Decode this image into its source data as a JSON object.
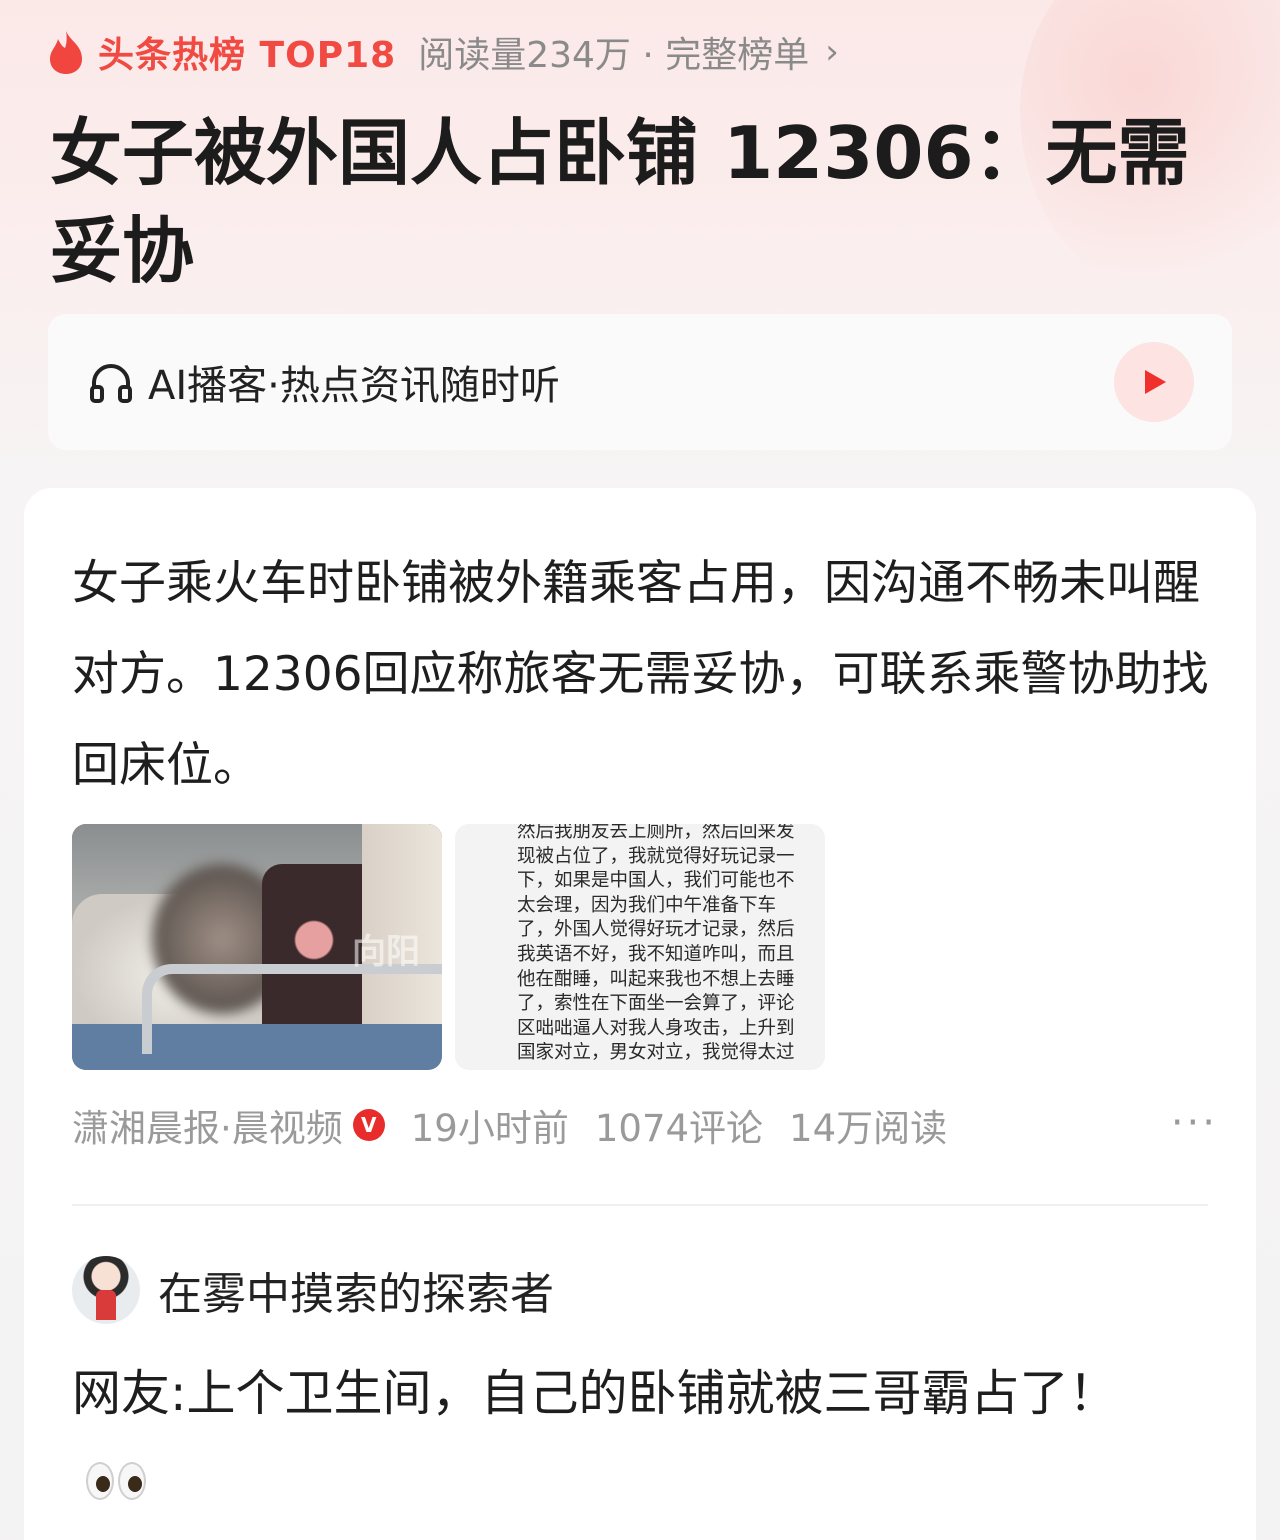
{
  "header": {
    "hot_label": "头条热榜 TOP18",
    "meta": "阅读量234万 · 完整榜单",
    "chevron": "›",
    "flame_icon": "flame-icon",
    "accent_color": "#f04a42"
  },
  "headline": "女子被外国人占卧铺 12306：无需妥协",
  "podcast": {
    "label": "AI播客·热点资讯随时听",
    "icon": "headphone-icon",
    "play_icon": "play-icon"
  },
  "article": {
    "summary": "女子乘火车时卧铺被外籍乘客占用，因沟通不畅未叫醒对方。12306回应称旅客无需妥协，可联系乘警协助找回床位。",
    "image_watermark": "向阳",
    "screenshot_text": "然后我朋友去上厕所，然后回来发现被占位了，我就觉得好玩记录一下，如果是中国人，我们可能也不太会理，因为我们中午准备下车了，外国人觉得好玩才记录，然后我英语不好，我不知道咋叫，而且他在酣睡，叫起来我也不想上去睡了，索性在下面坐一会算了，评论区咄咄逼人对我人身攻击，上升到国家对立，男女对立，我觉得太过",
    "source": "潇湘晨报·晨视频",
    "verified_badge": "V",
    "time": "19小时前",
    "comments": "1074评论",
    "reads": "14万阅读",
    "more": "···"
  },
  "comment": {
    "user_name": "在雾中摸索的探索者",
    "text": "网友:上个卫生间，自己的卧铺就被三哥霸占了！"
  }
}
